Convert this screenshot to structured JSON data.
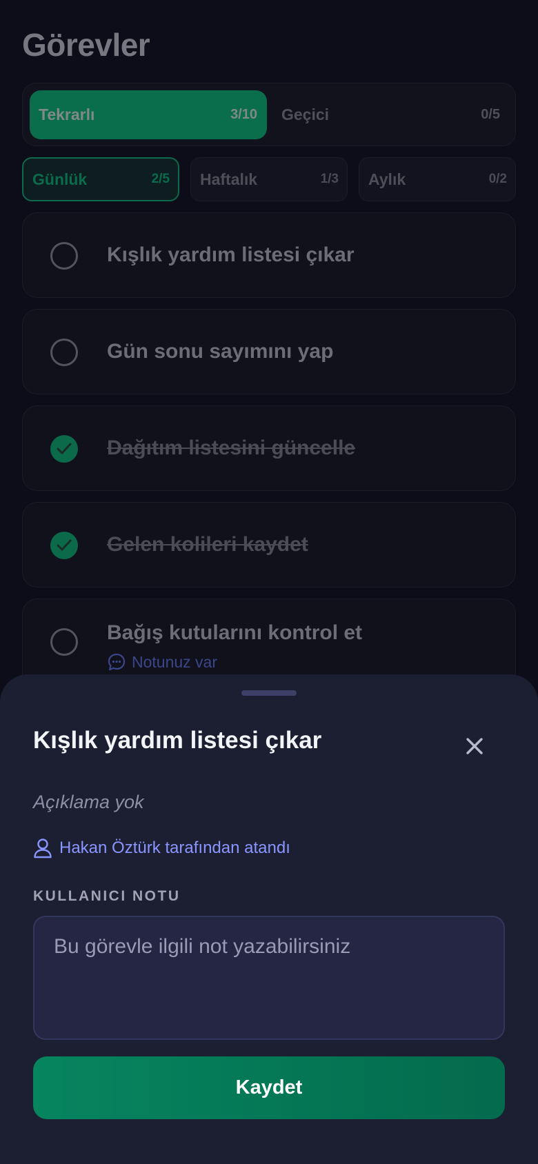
{
  "screen": {
    "title": "Görevler",
    "type_tabs": [
      {
        "label": "Tekrarlı",
        "count": "3/10",
        "active": true
      },
      {
        "label": "Geçici",
        "count": "0/5",
        "active": false
      }
    ],
    "period_tabs": [
      {
        "label": "Günlük",
        "count": "2/5",
        "active": true
      },
      {
        "label": "Haftalık",
        "count": "1/3",
        "active": false
      },
      {
        "label": "Aylık",
        "count": "0/2",
        "active": false
      }
    ],
    "tasks": [
      {
        "title": "Kışlık yardım listesi çıkar",
        "done": false
      },
      {
        "title": "Gün sonu sayımını yap",
        "done": false
      },
      {
        "title": "Dağıtım listesini güncelle",
        "done": true
      },
      {
        "title": "Gelen kolileri kaydet",
        "done": true
      },
      {
        "title": "Bağış kutularını kontrol et",
        "done": false,
        "note_label": "Notunuz var"
      }
    ]
  },
  "sheet": {
    "title": "Kışlık yardım listesi çıkar",
    "description": "Açıklama yok",
    "assigned_by": "Hakan Öztürk tarafından atandı",
    "note_section_label": "KULLANICI NOTU",
    "note_placeholder": "Bu görevle ilgili not yazabilirsiniz",
    "note_value": "",
    "save_label": "Kaydet"
  },
  "colors": {
    "accent_green": "#0a6e4c",
    "sheet_background": "#1c1e31",
    "link_blue": "#8a96ff"
  },
  "icons": {
    "close": "close-icon",
    "assigned": "user-icon",
    "note": "chat-bubble-icon",
    "done": "checkmark-icon"
  }
}
